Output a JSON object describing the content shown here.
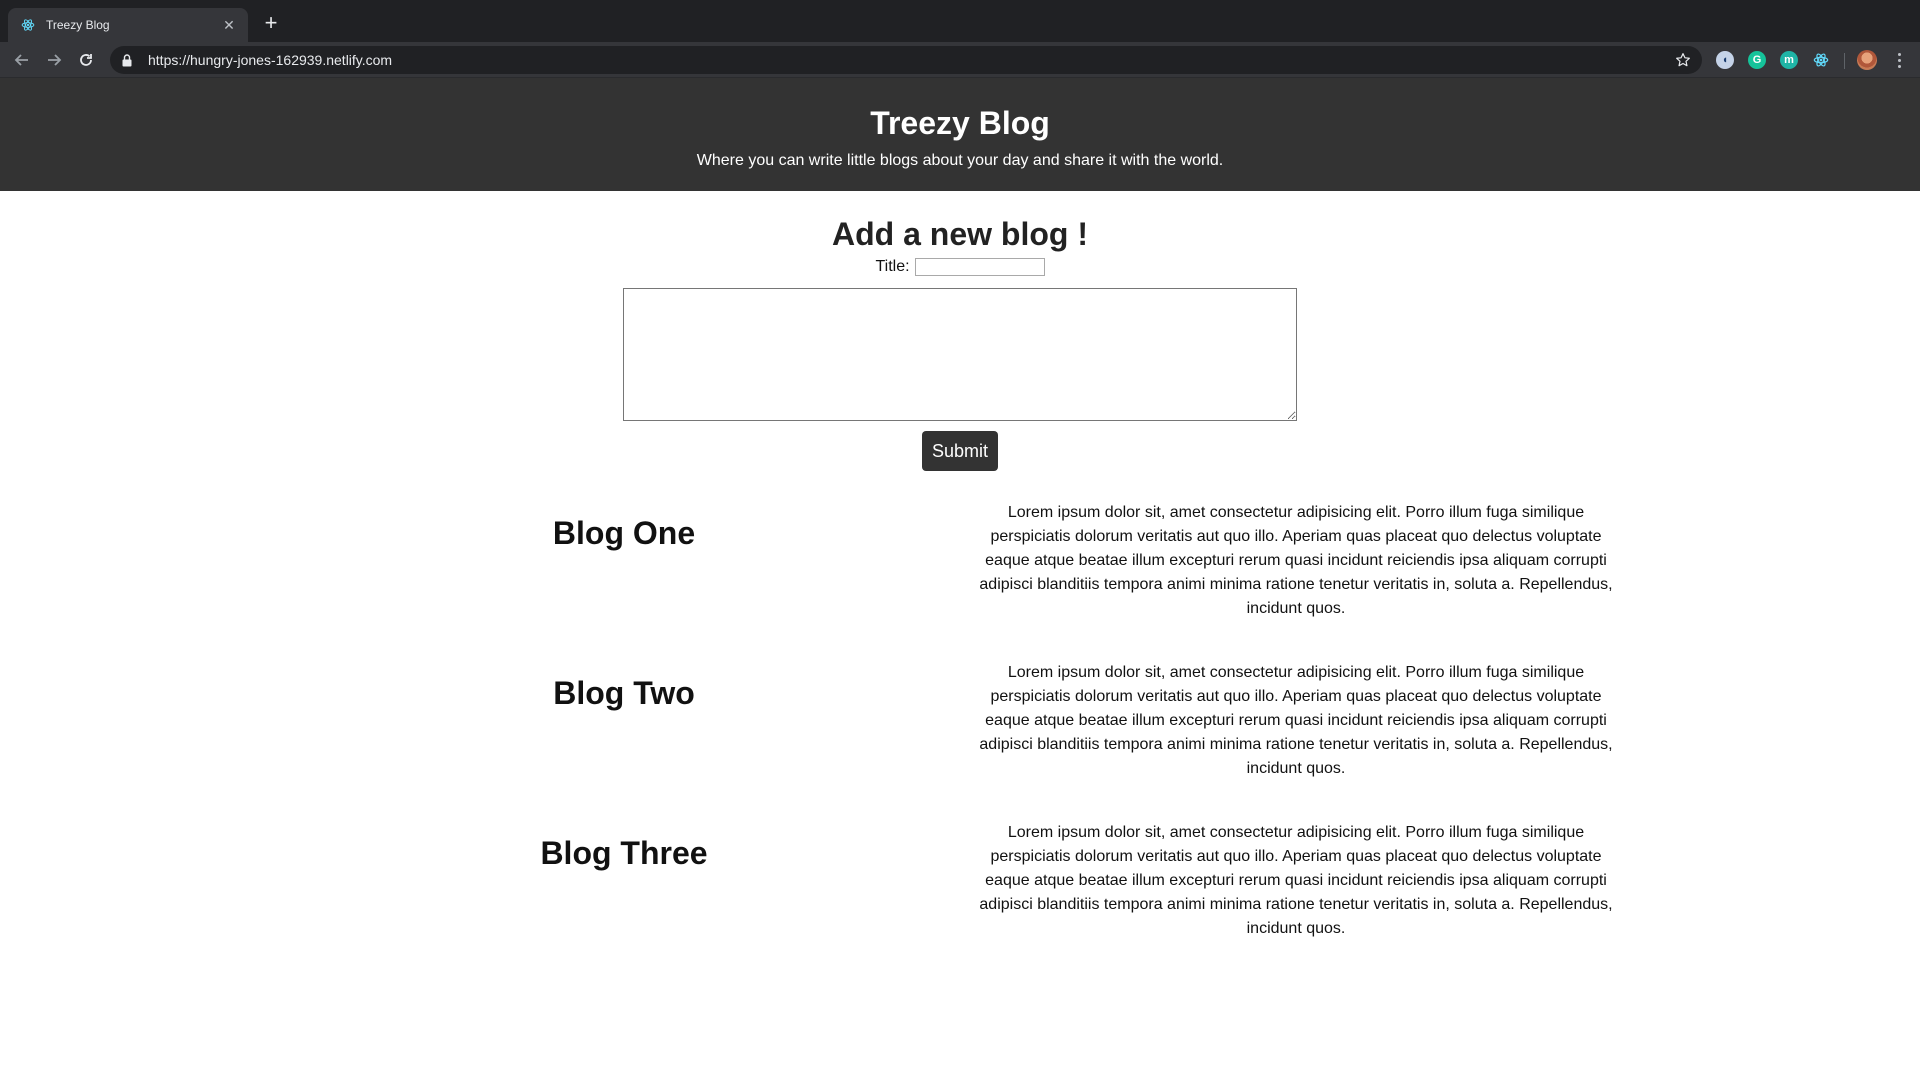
{
  "browser": {
    "tab_title": "Treezy Blog",
    "url": "https://hungry-jones-162939.netlify.com",
    "extensions": [
      "ghostery-icon",
      "grammarly-icon",
      "mercury-icon",
      "react-devtools-icon"
    ]
  },
  "site": {
    "title": "Treezy Blog",
    "tagline": "Where you can write little blogs about your day and share it with the world."
  },
  "form": {
    "heading": "Add a new blog !",
    "title_label": "Title:",
    "title_value": "",
    "body_value": "",
    "submit_label": "Submit"
  },
  "blogs": [
    {
      "title": "Blog One",
      "body": "Lorem ipsum dolor sit, amet consectetur adipisicing elit. Porro illum fuga similique perspiciatis dolorum veritatis aut quo illo. Aperiam quas placeat quo delectus voluptate eaque atque beatae illum excepturi rerum quasi incidunt reiciendis ipsa aliquam corrupti adipisci blanditiis tempora animi minima ratione tenetur veritatis in, soluta a. Repellendus, incidunt quos."
    },
    {
      "title": "Blog Two",
      "body": "Lorem ipsum dolor sit, amet consectetur adipisicing elit. Porro illum fuga similique perspiciatis dolorum veritatis aut quo illo. Aperiam quas placeat quo delectus voluptate eaque atque beatae illum excepturi rerum quasi incidunt reiciendis ipsa aliquam corrupti adipisci blanditiis tempora animi minima ratione tenetur veritatis in, soluta a. Repellendus, incidunt quos."
    },
    {
      "title": "Blog Three",
      "body": "Lorem ipsum dolor sit, amet consectetur adipisicing elit. Porro illum fuga similique perspiciatis dolorum veritatis aut quo illo. Aperiam quas placeat quo delectus voluptate eaque atque beatae illum excepturi rerum quasi incidunt reiciendis ipsa aliquam corrupti adipisci blanditiis tempora animi minima ratione tenetur veritatis in, soluta a. Repellendus, incidunt quos."
    }
  ],
  "colors": {
    "header_bg": "#333333",
    "button_bg": "#333333",
    "chrome_dark": "#202124",
    "chrome_toolbar": "#35363a"
  }
}
